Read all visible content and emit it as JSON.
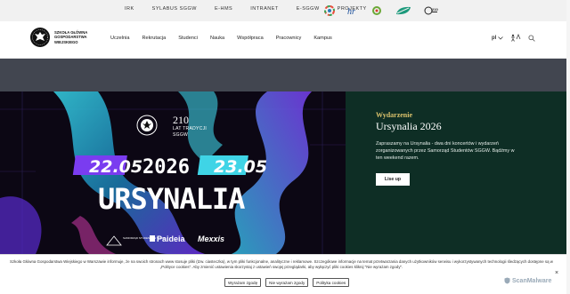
{
  "topbar": {
    "links": [
      "IRK",
      "SYLABUS SGGW",
      "E-HMS",
      "INTRANET",
      "E-SGGW",
      "PROJEKTY"
    ],
    "logos": [
      "colorwheel-logo",
      "hr-logo",
      "erasmus-logo",
      "green-leaf-logo",
      "anniversary-logo"
    ]
  },
  "brand": {
    "name_line1": "SZKOŁA GŁÓWNA",
    "name_line2": "GOSPODARSTWA",
    "name_line3": "WIEJSKIEGO"
  },
  "nav": {
    "items": [
      "Uczelnia",
      "Rekrutacja",
      "Studenci",
      "Nauka",
      "Współpraca",
      "Pracownicy",
      "Kampus"
    ]
  },
  "tools": {
    "lang": "pl",
    "icons": [
      "chevron-down-icon",
      "accessibility-icon",
      "search-icon"
    ]
  },
  "hero_image": {
    "anniversary_number": "210",
    "anniversary_text1": "LAT TRADYCJI",
    "anniversary_text2": "SGGW",
    "date_start": "22.05",
    "year": "2026",
    "date_end": "23.05",
    "event_name": "URSYNALIA",
    "sponsor1": "SAMORZĄD STUDENTÓW SGGW",
    "sponsor2": "Paideia",
    "sponsor3": "Mexxis"
  },
  "hero_panel": {
    "kicker": "Wydarzenie",
    "title": "Ursynalia 2026",
    "text": "Zapraszamy na Ursynalia - dwa dni koncertów i wydarzeń zorganizowanych przez Samorząd Studentów SGGW. Bądźmy w ten weekend razem.",
    "button": "Lise up"
  },
  "cookie": {
    "text": "Szkoła Główna Gospodarstwa Wiejskiego w Warszawie informuje, że na swoich stronach www stosuje pliki (tzw. ciasteczka), w tym pliki funkcjonalne, analityczne i reklamowe. Szczegółowe informacje na temat przetwarzania danych użytkowników serwisu i wykorzystywanych technologii śledzących dostępne są w „Polityce cookies\". Aby zmienić ustawienia skorzystaj z ustawień swojej przeglądarki, aby wyłączyć pliki cookies kliknij \"Nie wyrażam zgody\".",
    "accept": "Wyrażam zgodę",
    "reject": "Nie wyrażam zgody",
    "policy": "Polityka cookies",
    "close": "×",
    "watermark": "ScanMalware"
  },
  "colors": {
    "panel_bg": "#0e2e25",
    "kicker": "#d9c06b",
    "band": "#424650",
    "hero_cyan": "#3fd4e6",
    "hero_purple": "#7a3cf0"
  }
}
